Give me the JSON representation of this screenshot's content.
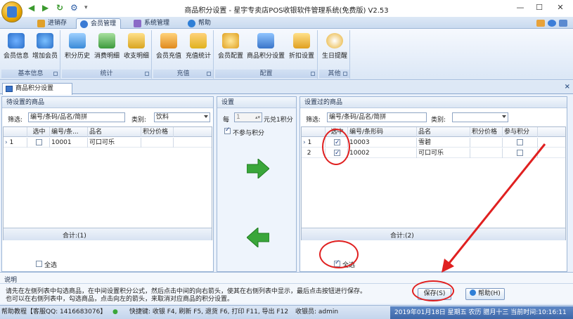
{
  "window": {
    "title": "商品积分设置 - 星宇专卖店POS收银软件管理系统(免费版) V2.53"
  },
  "tabs": [
    {
      "label": "进销存",
      "active": false
    },
    {
      "label": "会员管理",
      "active": true
    },
    {
      "label": "系统管理",
      "active": false
    },
    {
      "label": "帮助",
      "active": false
    }
  ],
  "ribbon": {
    "groups": [
      {
        "label": "基本信息",
        "buttons": [
          "会员信息",
          "增加会员"
        ]
      },
      {
        "label": "统计",
        "buttons": [
          "积分历史",
          "消费明细",
          "收支明细"
        ]
      },
      {
        "label": "充值",
        "buttons": [
          "会员充值",
          "充值统计"
        ]
      },
      {
        "label": "配置",
        "buttons": [
          "会员配置",
          "商品积分设置",
          "折扣设置"
        ]
      },
      {
        "label": "其他",
        "buttons": [
          "生日提醒"
        ]
      }
    ]
  },
  "doc_tab": {
    "label": "商品积分设置"
  },
  "left_panel": {
    "title": "待设置的商品",
    "filter_label": "筛选:",
    "filter_value": "编号/条码/品名/简拼",
    "category_label": "类别:",
    "category_value": "饮料",
    "columns": [
      "选中",
      "编号/条...",
      "品名",
      "积分价格"
    ],
    "rows": [
      {
        "num": "1",
        "checked": false,
        "code": "10001",
        "name": "可口可乐",
        "price": ""
      }
    ],
    "total": "合计:(1)",
    "select_all_label": "全选",
    "select_all_checked": false
  },
  "middle_panel": {
    "title": "设置",
    "rate_prefix": "每",
    "rate_value": "1",
    "rate_suffix": "元兑1积分",
    "exclude_label": "不参与积分",
    "exclude_checked": true
  },
  "right_panel": {
    "title": "设置过的商品",
    "filter_label": "筛选:",
    "filter_value": "编号/条码/品名/简拼",
    "category_label": "类别:",
    "category_value": "",
    "columns": [
      "选中",
      "编号/条形码",
      "品名",
      "积分价格",
      "参与积分"
    ],
    "rows": [
      {
        "num": "1",
        "checked": true,
        "code": "10003",
        "name": "雪碧",
        "price": "",
        "participate": false
      },
      {
        "num": "2",
        "checked": true,
        "code": "10002",
        "name": "可口可乐",
        "price": "",
        "participate": false
      }
    ],
    "total": "合计:(2)",
    "select_all_label": "全选",
    "select_all_checked": true
  },
  "info": {
    "title": "说明",
    "line1": "请先在左侧列表中勾选商品，在中间设置积分公式，然后点击中间的向右箭头，使其在右侧列表中显示，最后点击按钮进行保存。",
    "line2": "也可以在右侧列表中，勾选商品，点击向左的箭头，来取消对应商品的积分设置。",
    "save_label": "保存(S)",
    "help_label": "帮助(H)"
  },
  "status": {
    "help": "帮助教程【客服QQ: 1416683076】",
    "shortcuts": "快捷键: 收银 F4, 刷新 F5, 退货 F6, 打印 F11, 导出 F12",
    "cashier": "收银员: admin",
    "datetime": "2019年01月18日 星期五 农历 腊月十三 当前时间:10:16:11"
  },
  "colors": {
    "accent": "#3d67a8",
    "arrow_green": "#3aa63a",
    "annotation_red": "#e02020"
  }
}
